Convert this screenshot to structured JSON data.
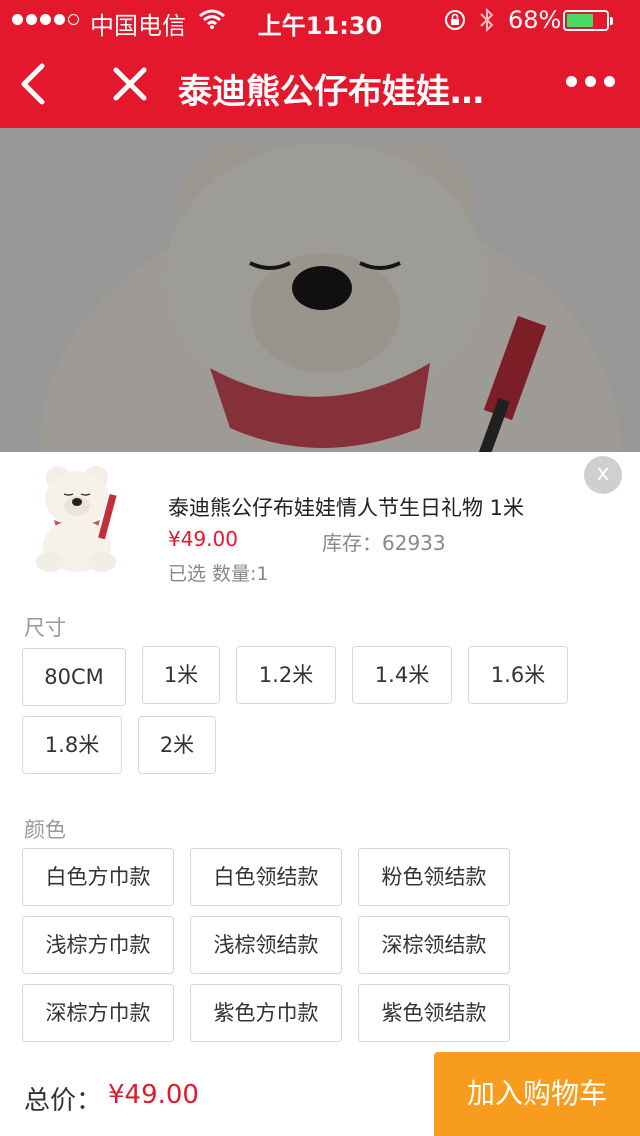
{
  "status_bar": {
    "carrier": "中国电信",
    "time": "上午11:30",
    "battery_percent": "68%",
    "battery_level": 0.68,
    "battery_color": "#4cd964"
  },
  "nav": {
    "title": "泰迪熊公仔布娃娃…",
    "back_icon": "chevron-left-icon",
    "close_icon": "close-icon",
    "more_icon": "more-icon",
    "background": "#e4182d"
  },
  "product": {
    "title": "泰迪熊公仔布娃娃情人节生日礼物 1米",
    "price": "¥49.00",
    "stock": "库存：62933",
    "selected": "已选   数量:1",
    "close_label": "x"
  },
  "size": {
    "label": "尺寸",
    "options": [
      "80CM",
      "1米",
      "1.2米",
      "1.4米",
      "1.6米",
      "1.8米",
      "2米"
    ]
  },
  "color": {
    "label": "颜色",
    "options": [
      "白色方巾款",
      "白色领结款",
      "粉色领结款",
      "浅棕方巾款",
      "浅棕领结款",
      "深棕领结款",
      "深棕方巾款",
      "紫色方巾款",
      "紫色领结款"
    ]
  },
  "footer": {
    "total_label": "总价：",
    "total_value": "¥49.00",
    "add_to_cart": "加入购物车",
    "accent": "#f89c1d"
  }
}
